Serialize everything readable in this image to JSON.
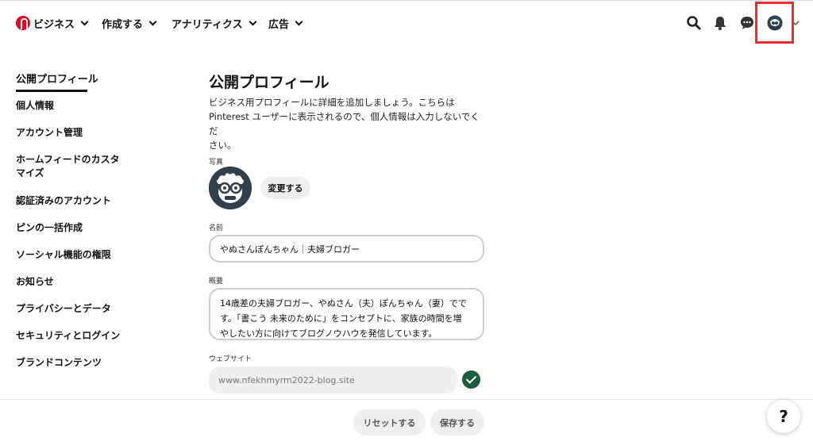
{
  "header": {
    "nav": [
      {
        "label": "ビジネス"
      },
      {
        "label": "作成する"
      },
      {
        "label": "アナリティクス"
      },
      {
        "label": "広告"
      }
    ],
    "icons": [
      "search-icon",
      "bell-icon",
      "chat-icon",
      "profile-avatar-icon",
      "chevron-down-icon"
    ],
    "brand_color": "#e60023",
    "highlight_color": "#ef2b2b"
  },
  "sidebar": {
    "items": [
      {
        "label": "公開プロフィール"
      },
      {
        "label": "個人情報"
      },
      {
        "label": "アカウント管理"
      },
      {
        "label": "ホームフィードのカスタ"
      },
      {
        "label": "マイズ"
      },
      {
        "label": "認証済みのアカウント"
      },
      {
        "label": "ピンの一括作成"
      },
      {
        "label": "ソーシャル機能の権限"
      },
      {
        "label": "お知らせ"
      },
      {
        "label": "プライバシーとデータ"
      },
      {
        "label": "セキュリティとログイン"
      },
      {
        "label": "ブランドコンテンツ"
      }
    ]
  },
  "main": {
    "title": "公開プロフィール",
    "intro_line1": "ビジネス用プロフィールに詳細を追加しましょう。こちらは",
    "intro_line2": "Pinterest ユーザーに表示されるので、個人情報は入力しないでくだ",
    "intro_line3": "さい。",
    "photo_label": "写真",
    "change_button": "変更する",
    "name_label": "名前",
    "name_value": "やぬさんぽんちゃん｜夫婦ブロガー",
    "about_label": "概要",
    "about_line1": "14歳差の夫婦ブロガー、やぬさん（夫）ぽんちゃん（妻）でで",
    "about_line2": "す。「書こう 未来のために」をコンセプトに、家族の時間を増",
    "about_line3": "やしたい方に向けてブログノウハウを発信しています。",
    "website_label": "ウェブサイト",
    "website_value": "www.nfekhmyrm2022-blog.site",
    "verified_color": "#1d5c3f"
  },
  "footer": {
    "reset_button": "リセットする",
    "save_button": "保存する",
    "help_label": "?"
  }
}
